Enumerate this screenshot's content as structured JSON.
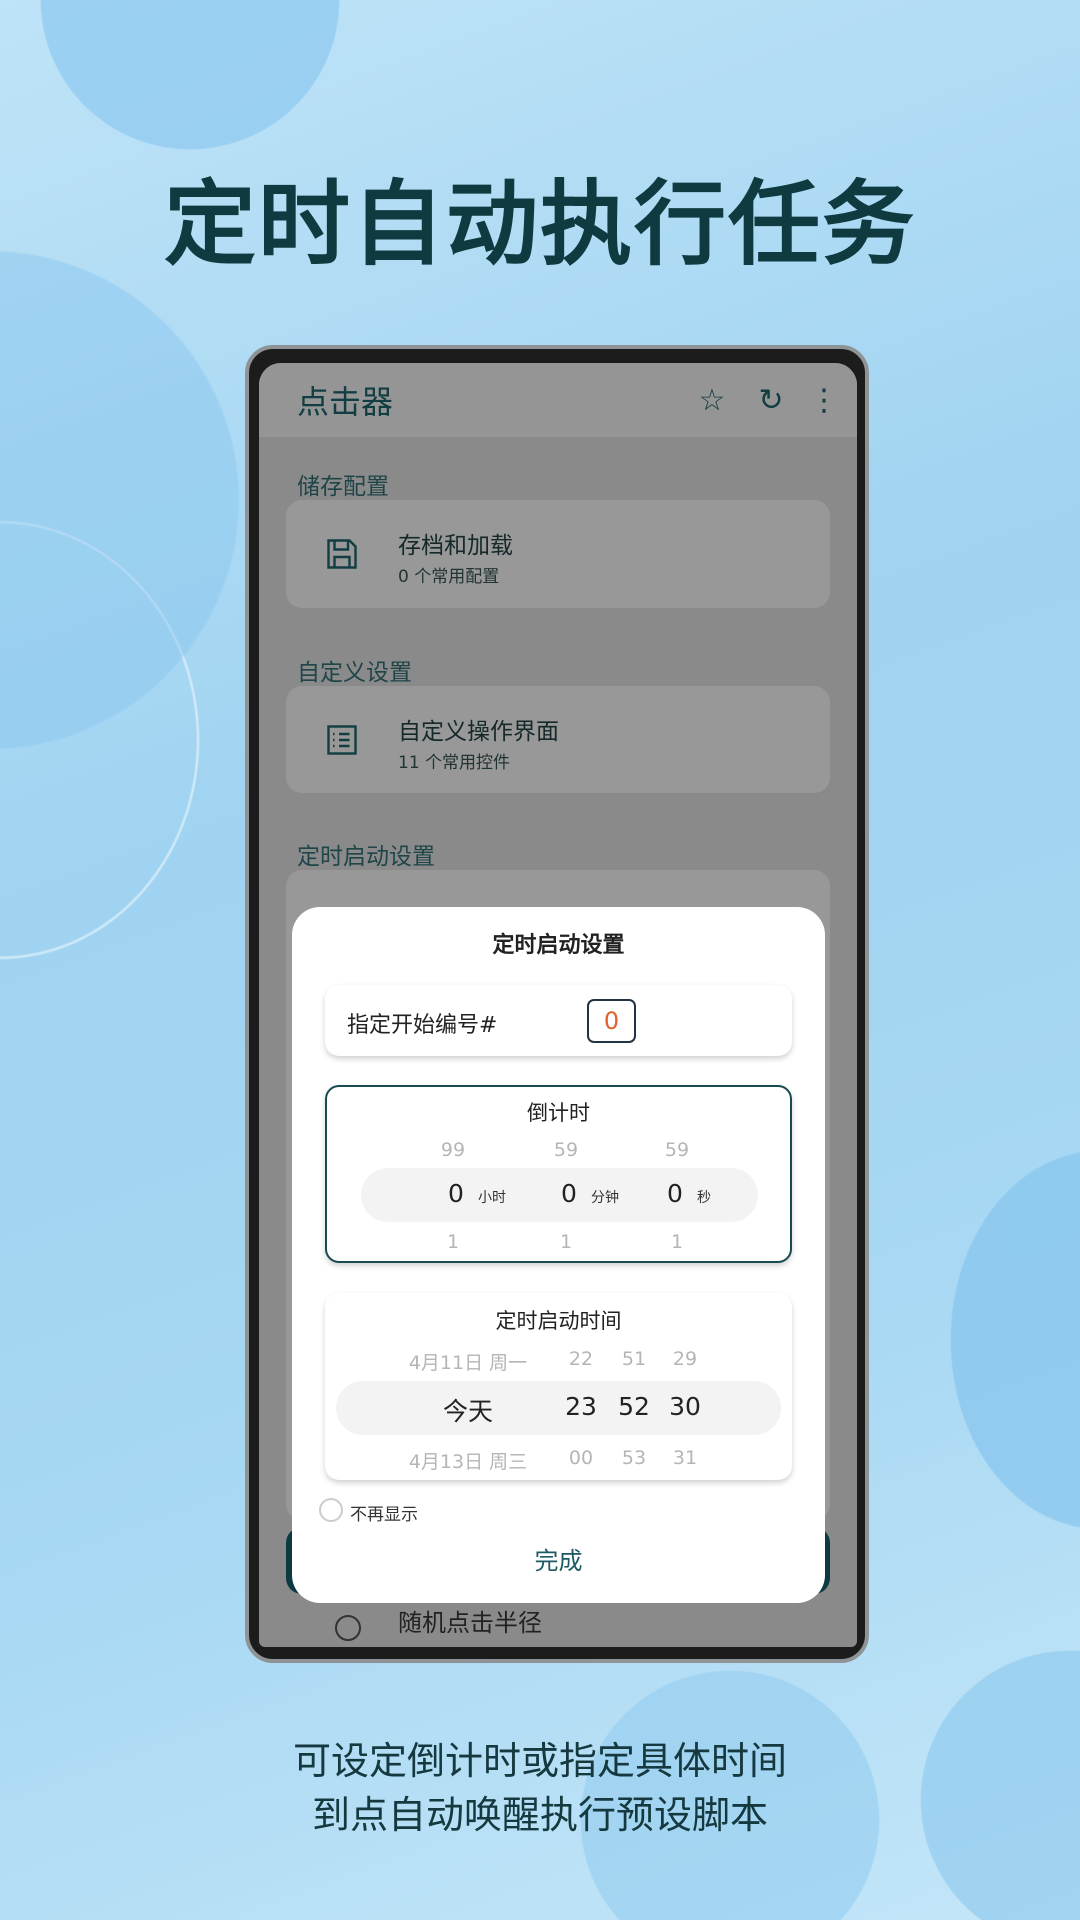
{
  "headline": "定时自动执行任务",
  "captions": [
    "可设定倒计时或指定具体时间",
    "到点自动唤醒执行预设脚本"
  ],
  "app": {
    "title": "点击器",
    "icons": [
      "star-icon",
      "refresh-icon",
      "more-vert-icon"
    ]
  },
  "sections": [
    {
      "label": "储存配置",
      "card": {
        "title": "存档和加载",
        "subtitle": "0 个常用配置",
        "icon": "save-icon"
      }
    },
    {
      "label": "自定义设置",
      "card": {
        "title": "自定义操作界面",
        "subtitle": "11 个常用控件",
        "icon": "list-icon"
      }
    },
    {
      "label": "定时启动设置"
    }
  ],
  "behind_text": "随机点击半径",
  "dialog": {
    "title": "定时启动设置",
    "start_number_label": "指定开始编号#",
    "start_number_value": "0",
    "countdown": {
      "title": "倒计时",
      "above": [
        "99",
        "59",
        "59"
      ],
      "values": [
        "0",
        "0",
        "0"
      ],
      "units": [
        "小时",
        "分钟",
        "秒"
      ],
      "below": [
        "1",
        "1",
        "1"
      ]
    },
    "schedule": {
      "title": "定时启动时间",
      "above": [
        "4月11日 周一",
        "22",
        "51",
        "29"
      ],
      "values": [
        "今天",
        "23",
        "52",
        "30"
      ],
      "below": [
        "4月13日 周三",
        "00",
        "53",
        "31"
      ]
    },
    "dont_show_label": "不再显示",
    "dont_show_checked": false,
    "done_label": "完成"
  },
  "colors": {
    "accent": "#123d42",
    "number_value": "#e0632e"
  }
}
